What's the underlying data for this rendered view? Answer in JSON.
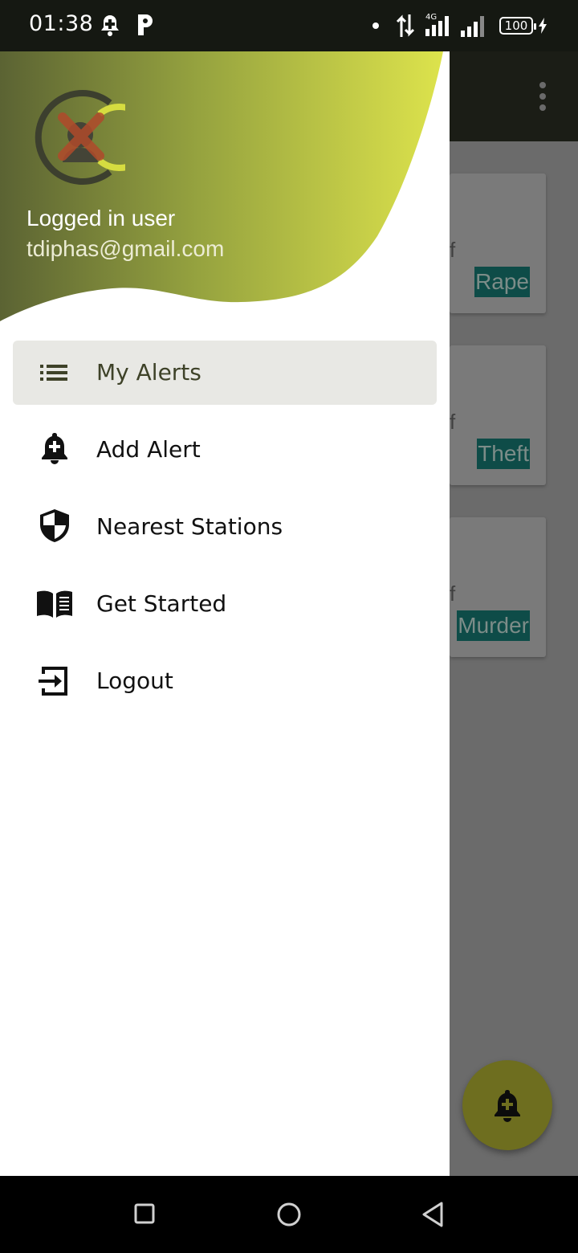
{
  "status_bar": {
    "time": "01:38",
    "battery": "100"
  },
  "background": {
    "cards": [
      {
        "text_fragment": "f",
        "tag": "Rape"
      },
      {
        "text_fragment": "f",
        "tag": "Theft"
      },
      {
        "text_fragment": "f",
        "tag": "Murder"
      }
    ]
  },
  "drawer": {
    "header": {
      "title": "Logged in user",
      "email": "tdiphas@gmail.com"
    },
    "menu": [
      {
        "label": "My Alerts",
        "icon": "list-icon",
        "active": true
      },
      {
        "label": "Add Alert",
        "icon": "add-alert-bell-icon",
        "active": false
      },
      {
        "label": "Nearest Stations",
        "icon": "shield-icon",
        "active": false
      },
      {
        "label": "Get Started",
        "icon": "book-icon",
        "active": false
      },
      {
        "label": "Logout",
        "icon": "logout-icon",
        "active": false
      }
    ]
  },
  "colors": {
    "accent": "#d8e04a",
    "header_dark": "#5c6332",
    "tag_bg": "#0e4c48"
  }
}
